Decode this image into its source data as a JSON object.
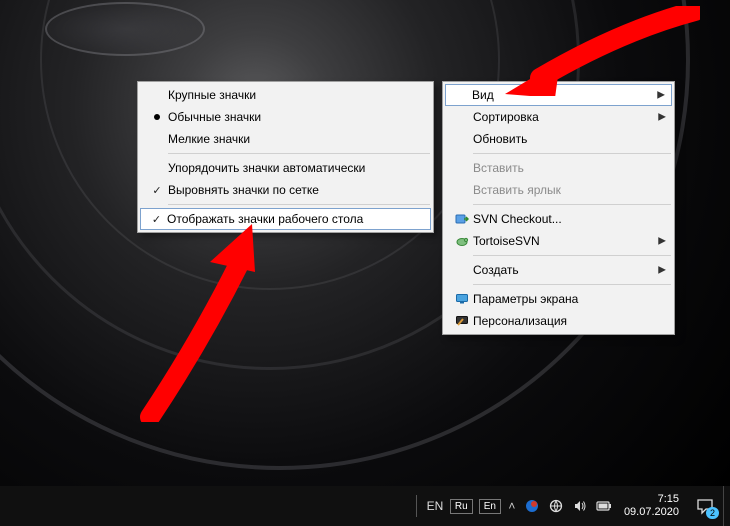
{
  "submenu": {
    "items": [
      {
        "label": "Крупные значки"
      },
      {
        "label": "Обычные значки"
      },
      {
        "label": "Мелкие значки"
      },
      {
        "label": "Упорядочить значки автоматически"
      },
      {
        "label": "Выровнять значки по сетке"
      },
      {
        "label": "Отображать значки рабочего стола"
      }
    ]
  },
  "mainmenu": {
    "items": [
      {
        "label": "Вид"
      },
      {
        "label": "Сортировка"
      },
      {
        "label": "Обновить"
      },
      {
        "label": "Вставить"
      },
      {
        "label": "Вставить ярлык"
      },
      {
        "label": "SVN Checkout..."
      },
      {
        "label": "TortoiseSVN"
      },
      {
        "label": "Создать"
      },
      {
        "label": "Параметры экрана"
      },
      {
        "label": "Персонализация"
      }
    ]
  },
  "taskbar": {
    "lang_short": "EN",
    "lang_box1": "Ru",
    "lang_box2": "En",
    "time": "7:15",
    "date": "09.07.2020",
    "notif_count": "2"
  }
}
